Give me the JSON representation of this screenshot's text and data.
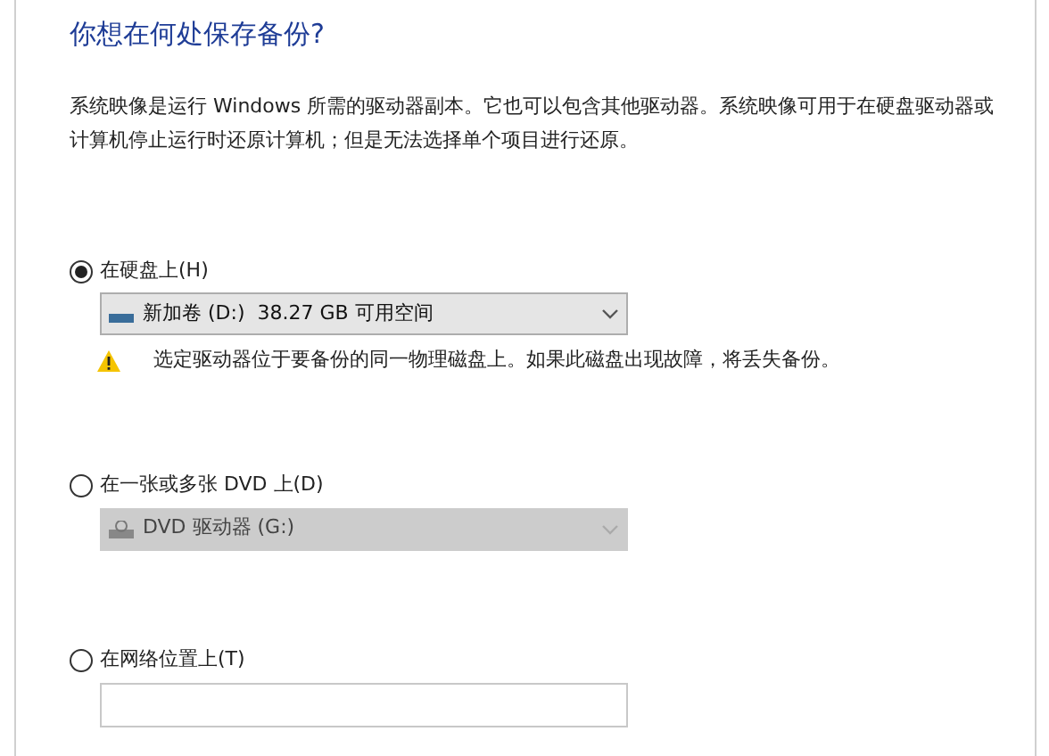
{
  "title": "你想在何处保存备份?",
  "description": "系统映像是运行 Windows 所需的驱动器副本。它也可以包含其他驱动器。系统映像可用于在硬盘驱动器或计算机停止运行时还原计算机；但是无法选择单个项目进行还原。",
  "options": [
    {
      "label": "在硬盘上(H)",
      "selected": true,
      "kind": "select",
      "value": "新加卷 (D:)  38.27 GB 可用空间",
      "disabled": false,
      "warning": "选定驱动器位于要备份的同一物理磁盘上。如果此磁盘出现故障，将丢失备份。"
    },
    {
      "label": "在一张或多张 DVD 上(D)",
      "selected": false,
      "kind": "select",
      "value": "DVD 驱动器 (G:)",
      "disabled": true
    },
    {
      "label": "在网络位置上(T)",
      "selected": false,
      "kind": "input"
    }
  ]
}
